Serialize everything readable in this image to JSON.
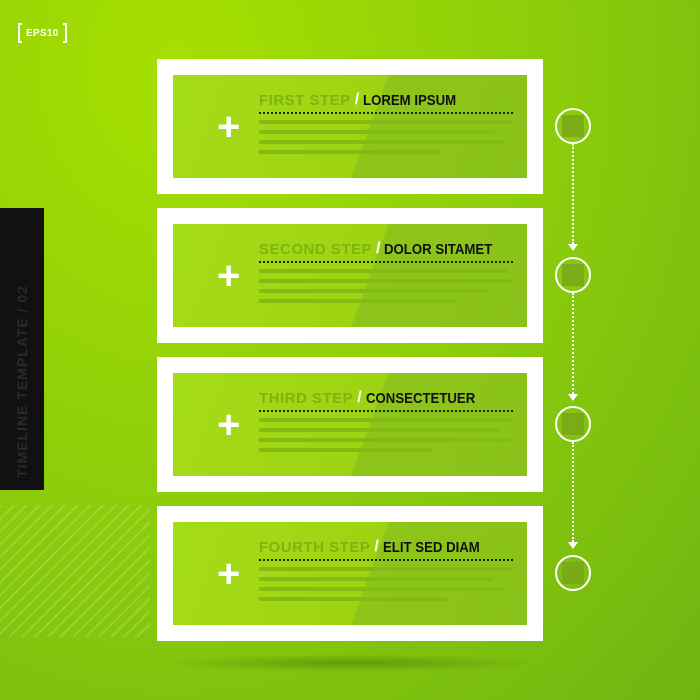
{
  "badge": {
    "label": "EPS10"
  },
  "side": {
    "vertical_text": "TIMELINE TEMPLATE / 02"
  },
  "steps": [
    {
      "label": "FIRST STEP",
      "separator": "/",
      "title": "LOREM IPSUM"
    },
    {
      "label": "SECOND STEP",
      "separator": "/",
      "title": "DOLOR SITAMET"
    },
    {
      "label": "THIRD STEP",
      "separator": "/",
      "title": "CONSECTETUER"
    },
    {
      "label": "FOURTH STEP",
      "separator": "/",
      "title": "ELIT SED DIAM"
    }
  ],
  "plus_symbol": "+",
  "colors": {
    "background": "#8fcf0a",
    "panel": "#a5dc18",
    "frame": "#ffffff",
    "title_text": "#111111",
    "side_block": "#111111"
  }
}
